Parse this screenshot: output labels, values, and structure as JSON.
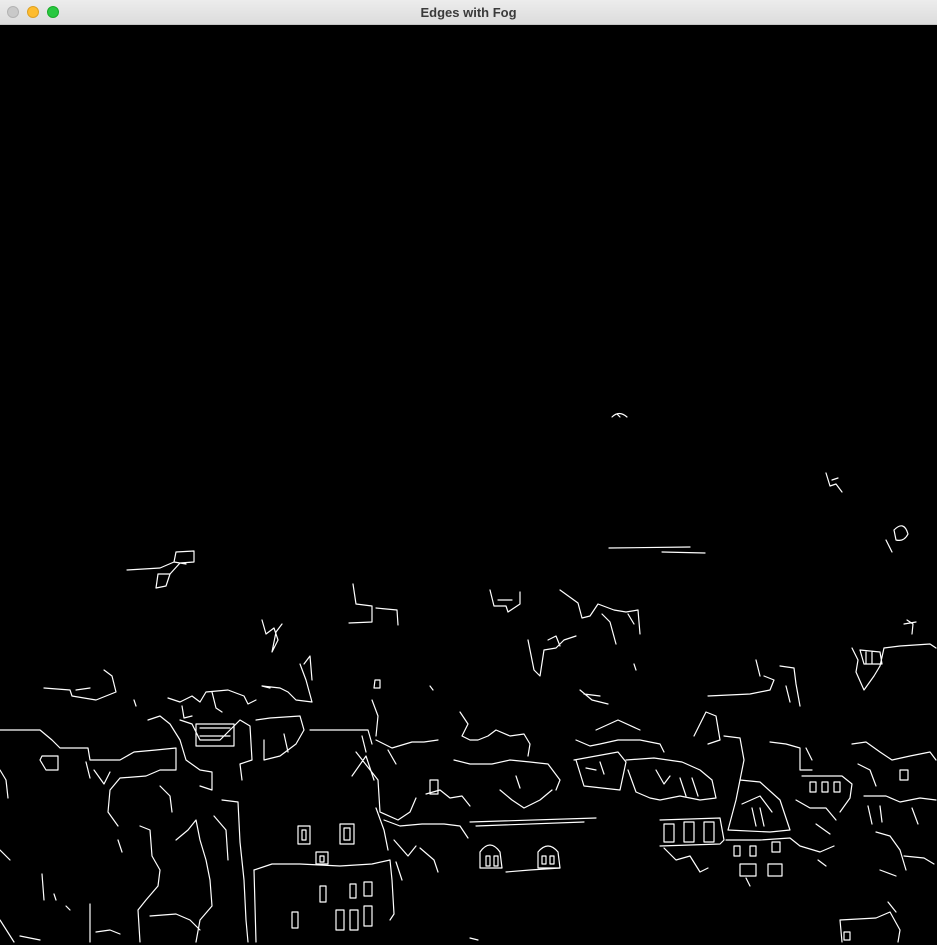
{
  "window": {
    "title": "Edges with Fog",
    "controls": {
      "close": "close-button",
      "minimize": "minimize-button",
      "zoom": "zoom-button"
    }
  },
  "image": {
    "description_icon": "canny-edge-map",
    "background_color": "#000000",
    "edge_color": "#ffffff"
  }
}
